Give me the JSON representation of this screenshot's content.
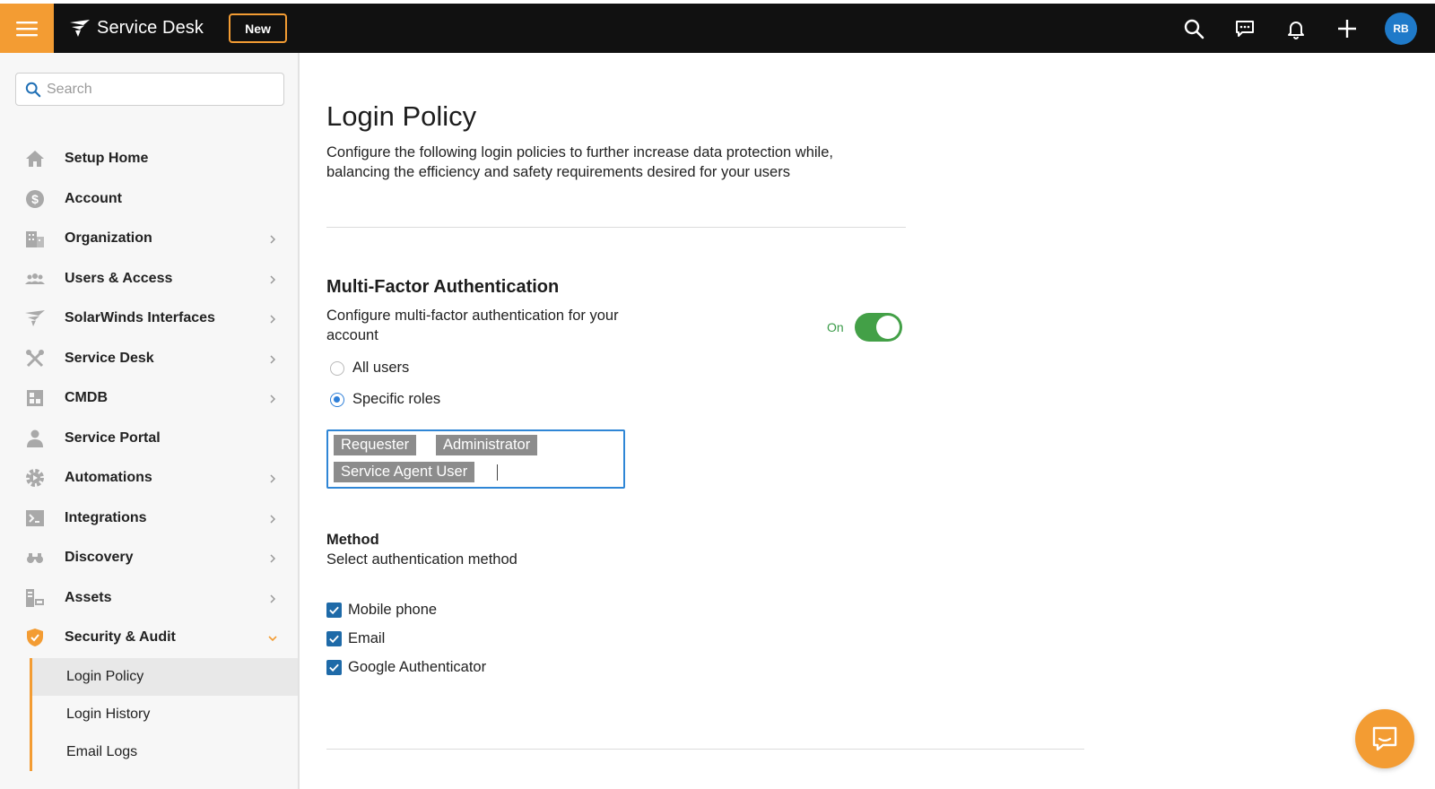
{
  "header": {
    "brand": "Service Desk",
    "new_button": "New",
    "avatar_initials": "RB",
    "icons": [
      "search-icon",
      "chat-icon",
      "bell-icon",
      "plus-icon"
    ]
  },
  "sidebar": {
    "search_placeholder": "Search",
    "items": [
      {
        "label": "Setup Home",
        "icon": "home-icon",
        "has_chevron": false
      },
      {
        "label": "Account",
        "icon": "dollar-icon",
        "has_chevron": false
      },
      {
        "label": "Organization",
        "icon": "building-icon",
        "has_chevron": true
      },
      {
        "label": "Users & Access",
        "icon": "users-icon",
        "has_chevron": true
      },
      {
        "label": "SolarWinds Interfaces",
        "icon": "solarwinds-icon",
        "has_chevron": true
      },
      {
        "label": "Service Desk",
        "icon": "tools-icon",
        "has_chevron": true
      },
      {
        "label": "CMDB",
        "icon": "cmdb-icon",
        "has_chevron": true
      },
      {
        "label": "Service Portal",
        "icon": "person-icon",
        "has_chevron": false
      },
      {
        "label": "Automations",
        "icon": "gear-play-icon",
        "has_chevron": true
      },
      {
        "label": "Integrations",
        "icon": "terminal-icon",
        "has_chevron": true
      },
      {
        "label": "Discovery",
        "icon": "binoculars-icon",
        "has_chevron": true
      },
      {
        "label": "Assets",
        "icon": "assets-icon",
        "has_chevron": true
      },
      {
        "label": "Security & Audit",
        "icon": "shield-icon",
        "has_chevron": true,
        "expanded": true
      }
    ],
    "sub_items": [
      {
        "label": "Login Policy",
        "active": true
      },
      {
        "label": "Login History",
        "active": false
      },
      {
        "label": "Email Logs",
        "active": false
      }
    ]
  },
  "main": {
    "title": "Login Policy",
    "description": "Configure the following login policies to further increase data protection while, balancing the efficiency and safety requirements desired for your users",
    "mfa": {
      "title": "Multi-Factor Authentication",
      "description": "Configure multi-factor authentication for your account",
      "toggle_label": "On",
      "enabled": true,
      "options": [
        {
          "label": "All users",
          "selected": false
        },
        {
          "label": "Specific roles",
          "selected": true
        }
      ],
      "roles": [
        "Requester",
        "Administrator",
        "Service Agent User"
      ]
    },
    "method": {
      "title": "Method",
      "description": "Select authentication method",
      "options": [
        {
          "label": "Mobile phone",
          "checked": true
        },
        {
          "label": "Email",
          "checked": true
        },
        {
          "label": "Google Authenticator",
          "checked": true
        }
      ]
    }
  },
  "colors": {
    "topbar": "#111111",
    "accent": "#f39c33",
    "toggle_on": "#43a047",
    "checkbox": "#1e6aa8",
    "radio_selected": "#2e7fd8",
    "avatar": "#1f7ac9"
  }
}
